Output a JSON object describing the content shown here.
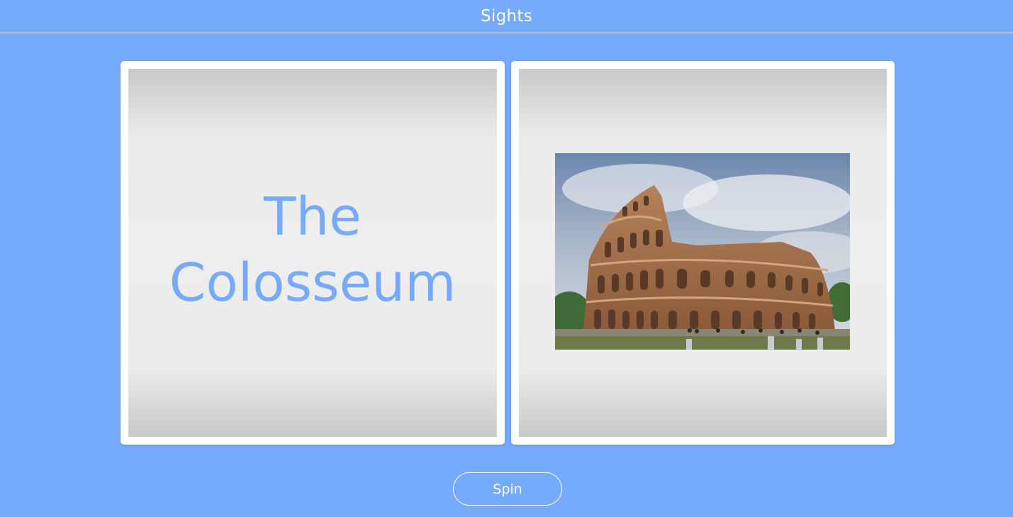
{
  "header": {
    "title": "Sights"
  },
  "cards": {
    "name_card": {
      "sight_name": "The Colosseum"
    },
    "image_card": {
      "image_subject": "colosseum-photo"
    }
  },
  "controls": {
    "spin_label": "Spin"
  },
  "colors": {
    "background": "#75aafc",
    "accent_text": "#75aafc",
    "card_background": "#ffffff",
    "panel_gradient_light": "#eeeeee",
    "panel_gradient_dark": "#c9c9c9"
  }
}
